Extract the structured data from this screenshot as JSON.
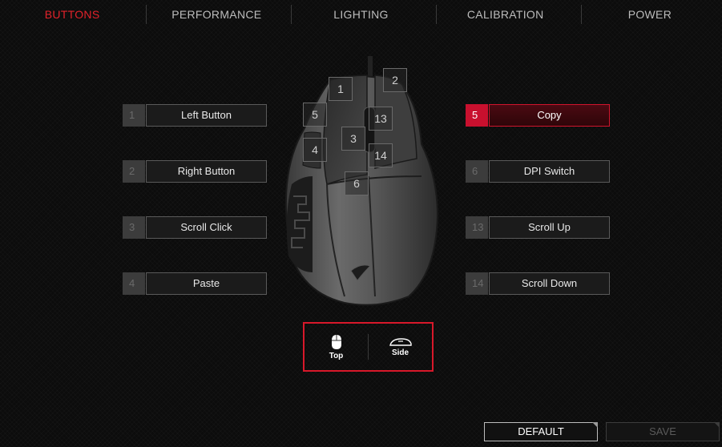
{
  "nav": {
    "tabs": [
      {
        "label": "BUTTONS",
        "active": true
      },
      {
        "label": "PERFORMANCE",
        "active": false
      },
      {
        "label": "LIGHTING",
        "active": false
      },
      {
        "label": "CALIBRATION",
        "active": false
      },
      {
        "label": "POWER",
        "active": false
      }
    ]
  },
  "left_slots": [
    {
      "num": "1",
      "label": "Left Button"
    },
    {
      "num": "2",
      "label": "Right Button"
    },
    {
      "num": "3",
      "label": "Scroll Click"
    },
    {
      "num": "4",
      "label": "Paste"
    }
  ],
  "right_slots": [
    {
      "num": "5",
      "label": "Copy",
      "selected": true
    },
    {
      "num": "6",
      "label": "DPI Switch"
    },
    {
      "num": "13",
      "label": "Scroll Up"
    },
    {
      "num": "14",
      "label": "Scroll Down"
    }
  ],
  "mouse_labels": [
    "1",
    "2",
    "5",
    "13",
    "3",
    "4",
    "14",
    "6"
  ],
  "view_toggle": {
    "top_label": "Top",
    "side_label": "Side",
    "top_icon": "mouse-top-icon",
    "side_icon": "mouse-side-icon"
  },
  "footer": {
    "default_label": "DEFAULT",
    "save_label": "SAVE"
  },
  "colors": {
    "accent": "#e3222a",
    "selected_num_bg": "#c8102e",
    "background": "#0c0c0c"
  }
}
